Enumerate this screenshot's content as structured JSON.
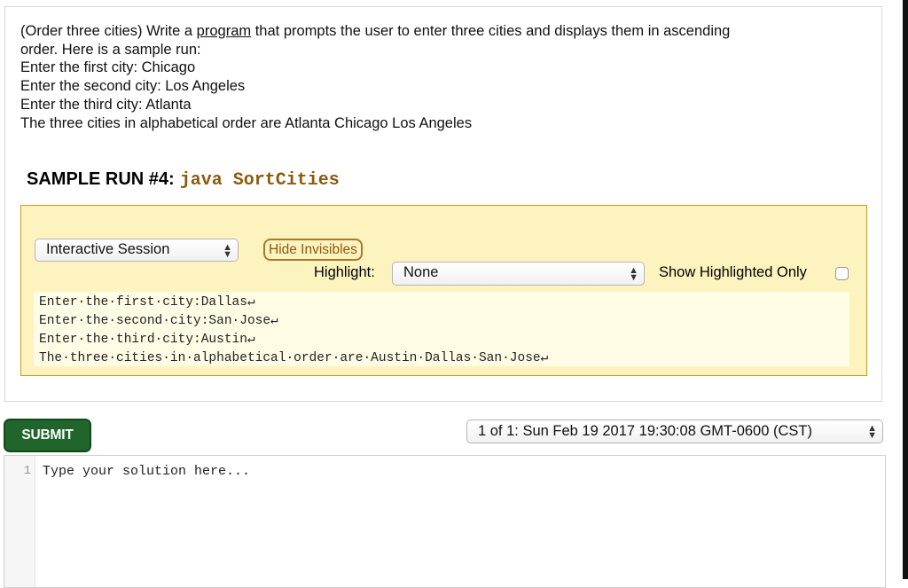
{
  "problem": {
    "lines": [
      {
        "before": "(Order three cities) Write a ",
        "link": "program",
        "after": "  that prompts the user to enter three cities and displays them in ascending"
      },
      {
        "text": "order. Here is a sample run:"
      },
      {
        "text": "Enter the first city: Chicago"
      },
      {
        "text": "Enter the second city: Los Angeles"
      },
      {
        "text": "Enter the third city: Atlanta"
      },
      {
        "text": "The three cities in alphabetical order are Atlanta Chicago Los Angeles"
      }
    ]
  },
  "sample_run": {
    "heading": "SAMPLE RUN #4:",
    "command": "java SortCities"
  },
  "session_panel": {
    "mode_select": "Interactive Session",
    "hide_invisibles_label": "Hide Invisibles",
    "highlight_label": "Highlight:",
    "highlight_select": "None",
    "show_highlighted_only_label": "Show Highlighted Only",
    "show_highlighted_only_checked": false,
    "output_lines": [
      "Enter·the·first·city:Dallas↵",
      "Enter·the·second·city:San·Jose↵",
      "Enter·the·third·city:Austin↵",
      "The·three·cities·in·alphabetical·order·are·Austin·Dallas·San·Jose↵"
    ]
  },
  "submit_label": "SUBMIT",
  "run_select": "1 of 1: Sun Feb 19 2017 19:30:08 GMT-0600 (CST)",
  "editor": {
    "line_number": "1",
    "placeholder": "Type your solution here..."
  },
  "colors": {
    "panel_bg": "#fdf3bf",
    "panel_border": "#c49a2c",
    "command": "#8b5a10",
    "submit_bg": "#20652b"
  },
  "icons": {
    "select_arrows": "updown-arrows-icon"
  }
}
